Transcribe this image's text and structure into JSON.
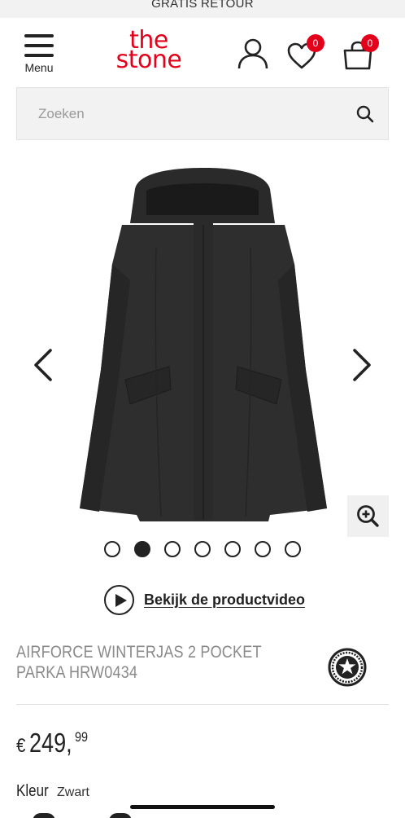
{
  "banner": {
    "text": "GRATIS RETOUR"
  },
  "header": {
    "menu_label": "Menu",
    "logo_line1": "the",
    "logo_line2": "stone",
    "wishlist_count": "0",
    "cart_count": "0"
  },
  "search": {
    "placeholder": "Zoeken"
  },
  "gallery": {
    "total_images": 7,
    "active_index": 1
  },
  "video": {
    "link_text": "Bekijk de productvideo"
  },
  "product": {
    "title": "AIRFORCE WINTERJAS 2 POCKET PARKA HRW0434",
    "price_currency": "€",
    "price_main": "249,",
    "price_cents": "99",
    "color_label": "Kleur",
    "color_value": "Zwart"
  },
  "colors": {
    "accent": "#e3001b",
    "text": "#222222",
    "muted": "#8a8a8a"
  }
}
